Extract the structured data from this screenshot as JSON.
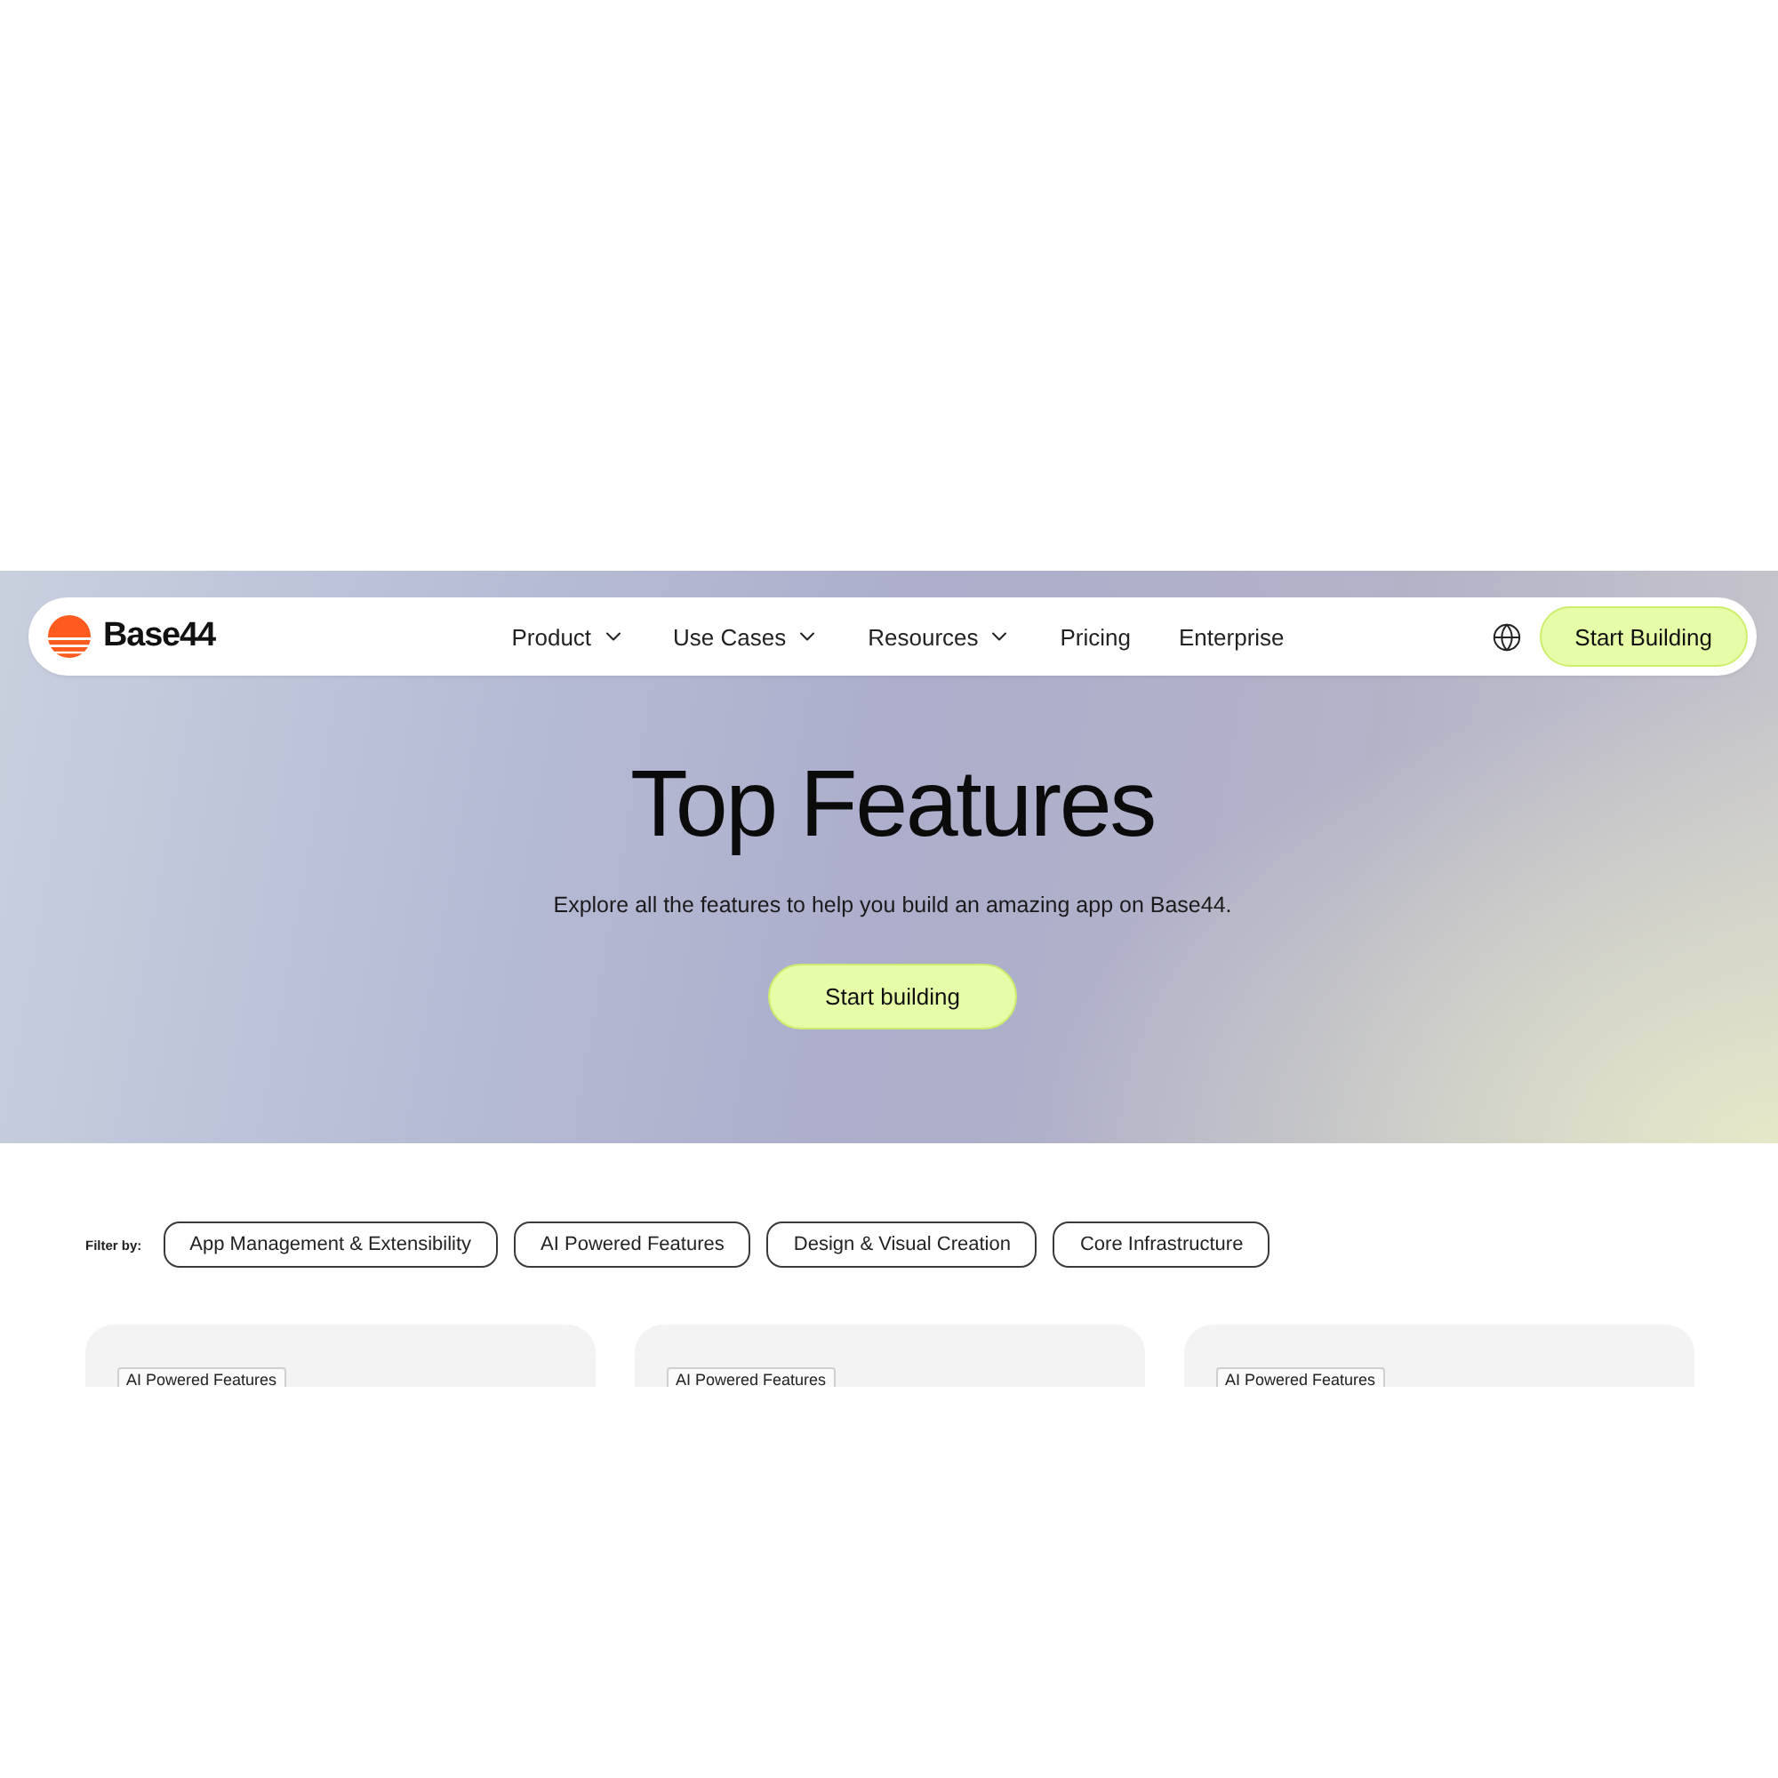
{
  "nav": {
    "logo": {
      "text": "Base44"
    },
    "items": [
      {
        "label": "Product",
        "kind": "menu"
      },
      {
        "label": "Use Cases",
        "kind": "menu"
      },
      {
        "label": "Resources",
        "kind": "menu"
      },
      {
        "label": "Pricing",
        "kind": "link"
      },
      {
        "label": "Enterprise",
        "kind": "link"
      }
    ],
    "cta": "Start Building"
  },
  "hero": {
    "title": "Top Features",
    "subtitle": "Explore all the features to help you build an amazing app on Base44.",
    "button": "Start building"
  },
  "filter": {
    "label": "Filter by:",
    "chips": [
      {
        "label": "App Management & Extensibility",
        "selected": false
      },
      {
        "label": "AI Powered Features",
        "selected": false
      },
      {
        "label": "Design & Visual Creation",
        "selected": false
      },
      {
        "label": "Core Infrastructure",
        "selected": false
      }
    ]
  },
  "cards": [
    {
      "tag": "AI Powered Features"
    },
    {
      "tag": "AI Powered Features"
    },
    {
      "tag": "AI Powered Features"
    }
  ]
}
